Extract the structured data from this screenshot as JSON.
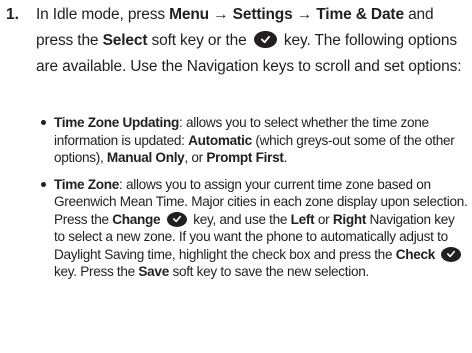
{
  "step": {
    "number": "1.",
    "t1": "In Idle mode, press ",
    "menu_path": "Menu → Settings → Time & Date",
    "t2": " and press the ",
    "select": "Select",
    "t3": " soft key or the ",
    "t4": " key. The following options are available. Use the Navigation keys to scroll and set options:"
  },
  "bullets": [
    {
      "term": "Time Zone Updating",
      "t1": ": allows you to select whether the time zone information is updated: ",
      "opt1": "Automatic",
      "t2": " (which greys-out some of the other options), ",
      "opt2": "Manual Only",
      "t3": ", or ",
      "opt3": "Prompt First",
      "t4": "."
    },
    {
      "term": "Time Zone",
      "t1": ": allows you to assign your current time zone based on Greenwich Mean Time. Major cities in each zone display upon selection. Press the ",
      "change": "Change",
      "t2": " key, and use the ",
      "left": "Left",
      "t3": " or ",
      "right": "Right",
      "t4": " Navigation key to select a new zone. If you want the phone to automatically adjust to Daylight Saving time, highlight the check box and press the ",
      "check": "Check",
      "t5": " key. Press the ",
      "save": "Save",
      "t6": " soft key to save the new selection."
    }
  ],
  "icons": {
    "ok_key": "ok-key-icon",
    "bullet": "bullet-icon"
  }
}
